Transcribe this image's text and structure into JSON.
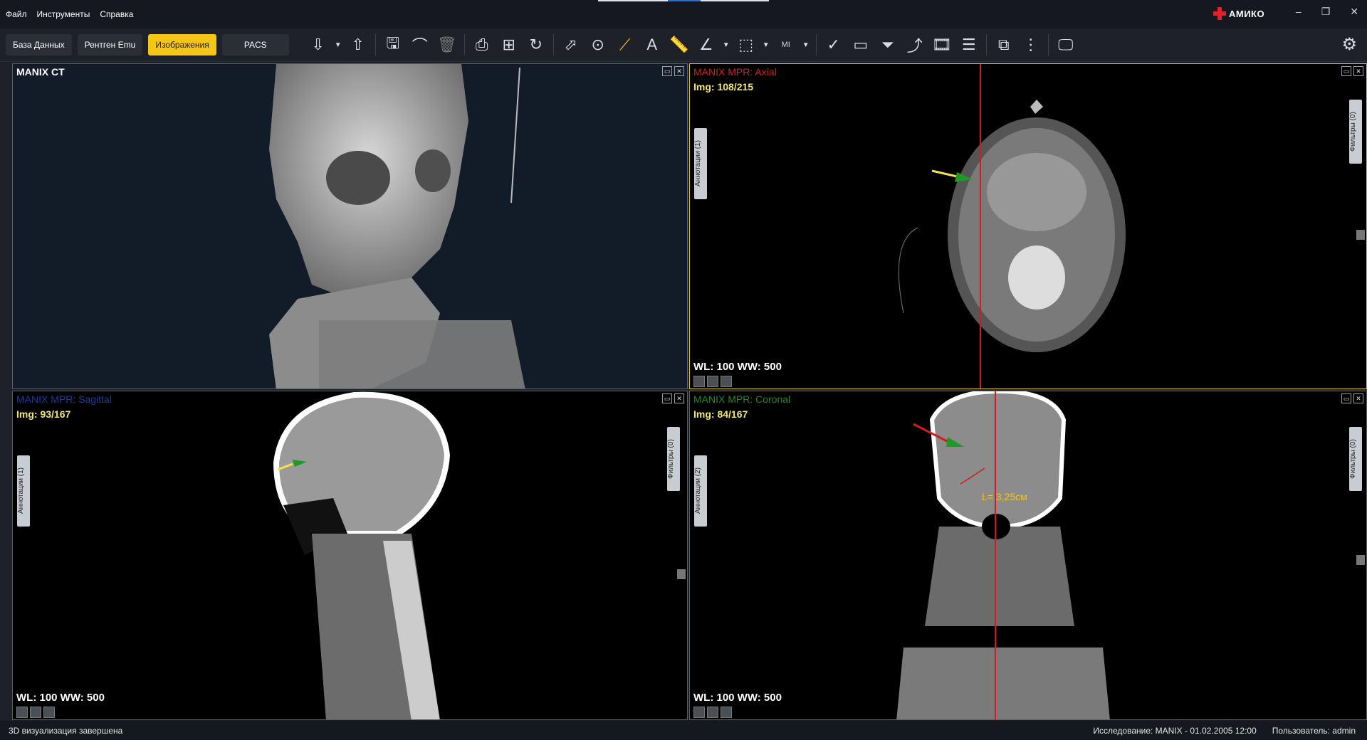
{
  "menu": [
    "Файл",
    "Инструменты",
    "Справка"
  ],
  "logo": "АМИКО",
  "tabs": {
    "db": "База Данных",
    "xray": "Рентген Emu",
    "images": "Изображения",
    "pacs": "PACS"
  },
  "toolbar_icons": [
    "download-icon",
    "upload-icon",
    "save-icon",
    "headphones-icon",
    "trash-icon",
    "print-icon",
    "grid-icon",
    "rotate-icon",
    "select-icon",
    "zoom-icon",
    "measure-line-icon",
    "text-annotation-icon",
    "ruler-icon",
    "angle-icon",
    "roi-icon",
    "mi-icon",
    "check-icon",
    "window-icon",
    "filter-icon",
    "curve-icon",
    "film-icon",
    "report-icon",
    "3d-icon",
    "mpr-icon",
    "monitor-icon"
  ],
  "mi_label": "MI",
  "vp1": {
    "title": "MANIX CT"
  },
  "vp2": {
    "title": "MANIX  MPR: Axial",
    "img": "Img: 108/215",
    "wl": "WL: 100 WW: 500",
    "ann": "Аннотации (1)",
    "filters": "Фильтры (0)",
    "title_color": "#d42020"
  },
  "vp3": {
    "title": "MANIX  MPR: Sagittal",
    "img": "Img: 93/167",
    "wl": "WL: 100 WW: 500",
    "ann": "Аннотации (1)",
    "filters": "Фильтры (0)",
    "title_color": "#1d3aa6"
  },
  "vp4": {
    "title": "MANIX  MPR: Coronal",
    "img": "Img: 84/167",
    "wl": "WL: 100 WW: 500",
    "ann": "Аннотации (2)",
    "filters": "Фильтры (0)",
    "measure": "L= 3,25см",
    "title_color": "#1f8a24"
  },
  "status": {
    "left": "3D визуализация завершена",
    "study": "Исследование: MANIX - 01.02.2005 12:00",
    "user": "Пользователь: admin"
  }
}
